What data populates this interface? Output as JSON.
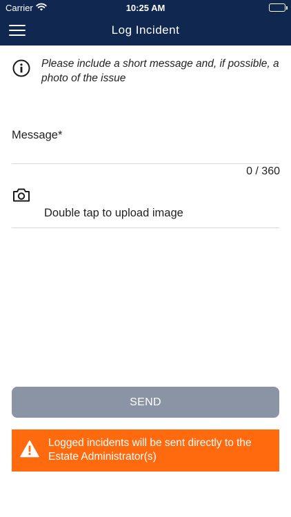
{
  "status_bar": {
    "carrier": "Carrier",
    "time": "10:25 AM",
    "icons": [
      "wifi-icon",
      "battery-icon"
    ]
  },
  "navbar": {
    "title": "Log Incident",
    "menu_icon": "hamburger-menu-icon"
  },
  "info": {
    "icon": "info-icon",
    "text": "Please include a short message and, if possible, a photo of the issue"
  },
  "message": {
    "label": "Message*",
    "value": "",
    "counter": "0 / 360"
  },
  "upload": {
    "icon": "camera-icon",
    "label": "Double tap to upload image"
  },
  "send_button": {
    "label": "SEND",
    "color": "#8a94a4"
  },
  "banner": {
    "icon": "warning-icon",
    "text": "Logged incidents will be sent directly to the Estate Administrator(s)",
    "color": "#ff6a0f"
  },
  "theme": {
    "header_color": "#10284f"
  }
}
